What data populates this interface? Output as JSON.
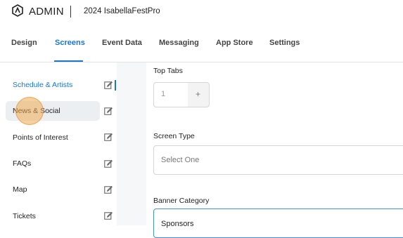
{
  "header": {
    "brand": "ADMIN",
    "app_name": "2024 IsabellaFestPro"
  },
  "tabs": [
    {
      "label": "Design"
    },
    {
      "label": "Screens"
    },
    {
      "label": "Event Data"
    },
    {
      "label": "Messaging"
    },
    {
      "label": "App Store"
    },
    {
      "label": "Settings"
    }
  ],
  "active_tab": "Screens",
  "sidebar": {
    "items": [
      {
        "label": "Schedule & Artists",
        "state": "active"
      },
      {
        "label": "News & Social",
        "state": "hover"
      },
      {
        "label": "Points of Interest"
      },
      {
        "label": "FAQs"
      },
      {
        "label": "Map"
      },
      {
        "label": "Tickets"
      }
    ]
  },
  "form": {
    "top_tabs_label": "Top Tabs",
    "top_tabs_value": "1",
    "plus_label": "+",
    "screen_type_label": "Screen Type",
    "screen_type_value": "Select One",
    "banner_category_label": "Banner Category",
    "banner_category_value": "Sponsors"
  },
  "colors": {
    "accent": "#1976d2",
    "hover_bg": "#eceff1",
    "cursor_highlight": "#f0aa50"
  }
}
